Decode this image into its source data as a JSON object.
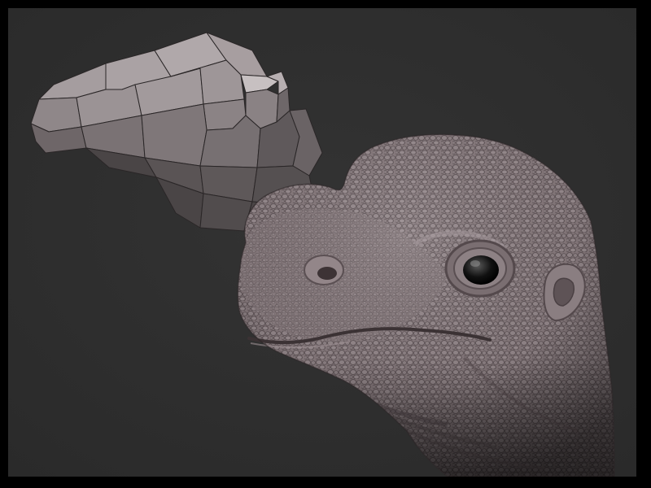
{
  "scene": {
    "background_color": "#2e2e2e",
    "frame_color": "#000000",
    "models": [
      {
        "id": "base-mesh",
        "kind": "low-poly head mesh",
        "color": "#8f8688"
      },
      {
        "id": "sculpt",
        "kind": "detailed reptile head sculpt",
        "color": "#85787b"
      }
    ]
  }
}
